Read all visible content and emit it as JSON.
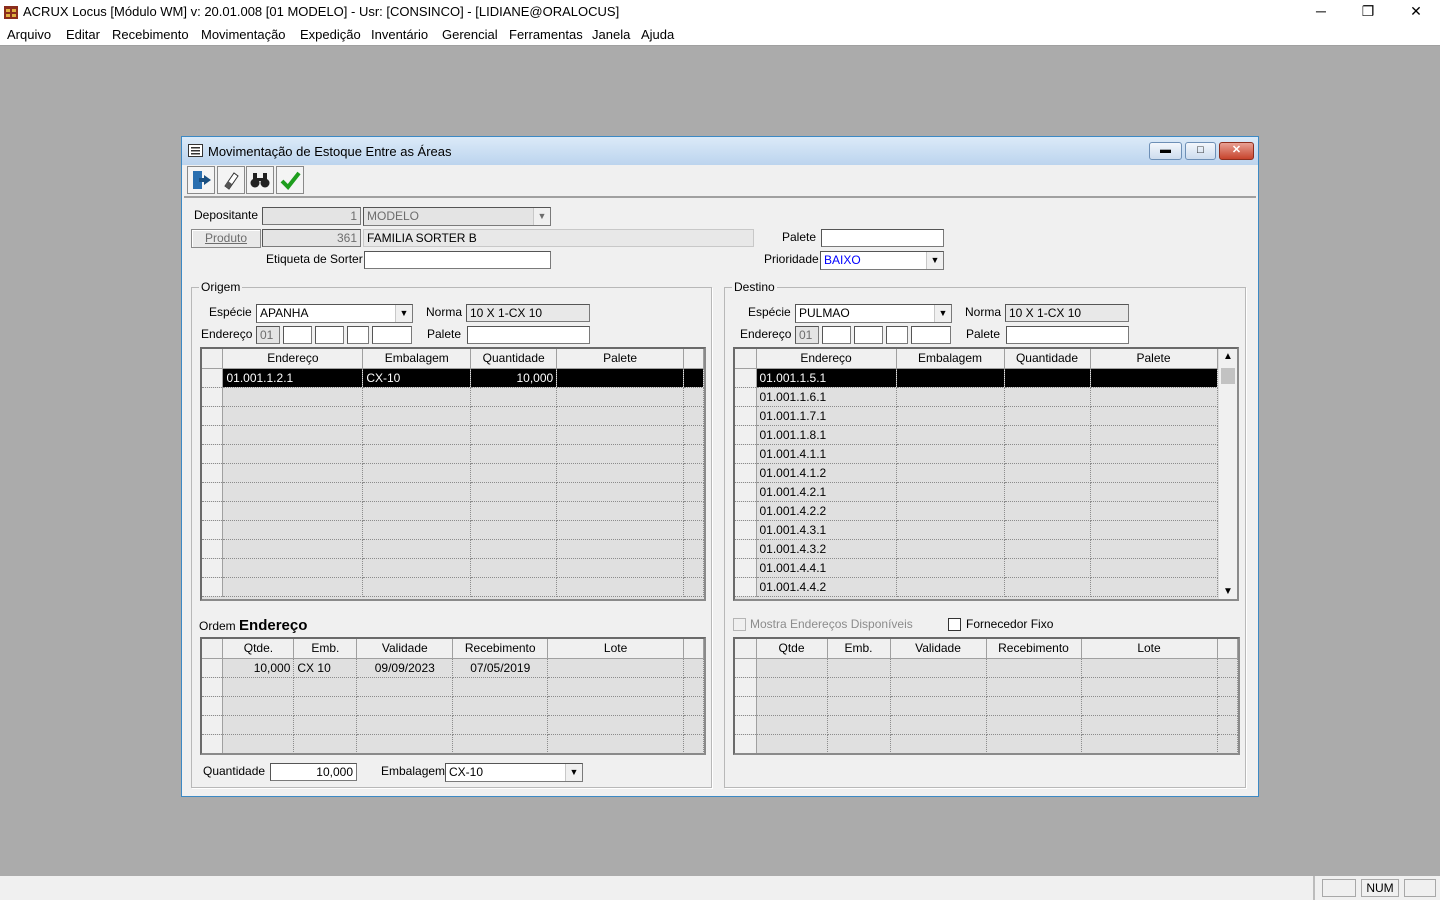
{
  "window": {
    "title": "ACRUX Locus [Módulo WM]  v: 20.01.008   [01 MODELO] - Usr: [CONSINCO] - [LIDIANE@ORALOCUS]",
    "controls": {
      "minimize": "─",
      "restore": "❐",
      "close": "✕"
    }
  },
  "menu": [
    "Arquivo",
    "Editar",
    "Recebimento",
    "Movimentação",
    "Expedição",
    "Inventário",
    "Gerencial",
    "Ferramentas",
    "Janela",
    "Ajuda"
  ],
  "dialog": {
    "title": "Movimentação de Estoque Entre as Áreas",
    "toolbar_icons": [
      "exit-door-icon",
      "eraser-icon",
      "binoculars-icon",
      "checkmark-icon"
    ],
    "depositante": {
      "label": "Depositante",
      "code": "1",
      "name": "MODELO"
    },
    "produto": {
      "label": "Produto",
      "code": "361",
      "name": "FAMILIA SORTER B"
    },
    "etiqueta": {
      "label": "Etiqueta de Sorter",
      "value": ""
    },
    "palete": {
      "label": "Palete",
      "value": ""
    },
    "prioridade": {
      "label": "Prioridade",
      "value": "BAIXO",
      "color": "#0000ff"
    },
    "origem": {
      "title": "Origem",
      "especie_label": "Espécie",
      "especie": "APANHA",
      "norma_label": "Norma",
      "norma": "10 X 1-CX 10",
      "endereco_label": "Endereço",
      "endereco_first": "01",
      "palete_label": "Palete",
      "grid": {
        "columns": [
          "Endereço",
          "Embalagem",
          "Quantidade",
          "Palete"
        ],
        "rows": [
          {
            "endereco": "01.001.1.2.1",
            "embalagem": "CX-10",
            "quantidade": "10,000",
            "palete": ""
          }
        ]
      },
      "ordem_label": "Ordem",
      "ordem_value": "Endereço",
      "lote_grid": {
        "columns": [
          "Qtde.",
          "Emb.",
          "Validade",
          "Recebimento",
          "Lote"
        ],
        "rows": [
          {
            "qtde": "10,000",
            "emb": "CX 10",
            "validade": "09/09/2023",
            "recebimento": "07/05/2019",
            "lote": ""
          }
        ]
      },
      "quantidade_label": "Quantidade",
      "quantidade": "10,000",
      "embalagem_label": "Embalagem",
      "embalagem": "CX-10"
    },
    "destino": {
      "title": "Destino",
      "especie_label": "Espécie",
      "especie": "PULMAO",
      "norma_label": "Norma",
      "norma": "10 X 1-CX 10",
      "endereco_label": "Endereço",
      "endereco_first": "01",
      "palete_label": "Palete",
      "grid": {
        "columns": [
          "Endereço",
          "Embalagem",
          "Quantidade",
          "Palete"
        ],
        "rows": [
          "01.001.1.5.1",
          "01.001.1.6.1",
          "01.001.1.7.1",
          "01.001.1.8.1",
          "01.001.4.1.1",
          "01.001.4.1.2",
          "01.001.4.2.1",
          "01.001.4.2.2",
          "01.001.4.3.1",
          "01.001.4.3.2",
          "01.001.4.4.1",
          "01.001.4.4.2"
        ]
      },
      "mostra_label": "Mostra Endereços Disponíveis",
      "fornecedor_label": "Fornecedor Fixo",
      "lote_grid": {
        "columns": [
          "Qtde",
          "Emb.",
          "Validade",
          "Recebimento",
          "Lote"
        ]
      }
    }
  },
  "status": {
    "num": "NUM"
  }
}
